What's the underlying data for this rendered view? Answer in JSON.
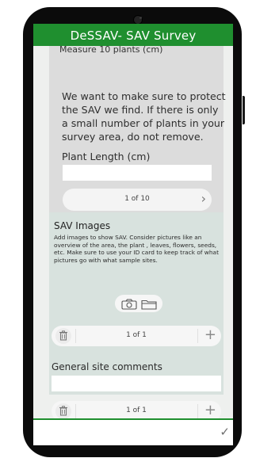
{
  "app": {
    "title": "DeSSAV-  SAV Survey"
  },
  "measure_group": {
    "heading_cut": "Measure 10 plants (cm)",
    "instruction": "We want to make sure to protect the SAV we find. If there is only a small number of plants in your survey area, do not remove.",
    "plant_length_label": "Plant Length (cm)",
    "plant_length_value": "",
    "pager_count": "1 of 10",
    "pager_next_glyph": "›"
  },
  "sav_images": {
    "title": "SAV Images",
    "description": "Add images to show SAV. Consider pictures like an overview of the area, the plant , leaves, flowers, seeds, etc. Make sure to use your ID card to keep track of what pictures go with what sample sites.",
    "icons": [
      "camera-icon",
      "folder-icon"
    ],
    "pager_count": "1 of 1",
    "add_glyph": "+"
  },
  "general_comments": {
    "label": "General site comments",
    "value": "",
    "pager_count": "1 of 1",
    "add_glyph": "+"
  },
  "footer": {
    "submit_glyph": "✓"
  },
  "colors": {
    "accent": "#1f8f2f",
    "panel": "#dcdcdc",
    "images_panel": "#d8e2de"
  }
}
